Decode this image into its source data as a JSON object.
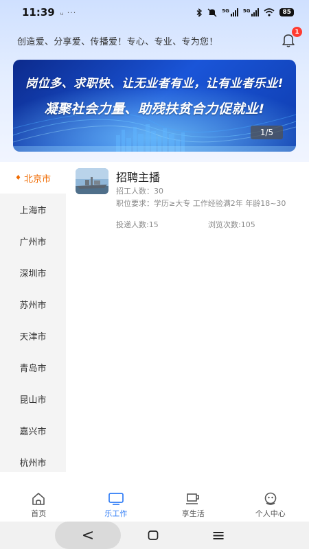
{
  "status_bar": {
    "time": "11:39",
    "extra": "ᵤ ···",
    "net1": "5G",
    "net2": "5G",
    "battery": "85"
  },
  "header": {
    "slogan": "创造爱、分享爱、传播爱！专心、专业、专为您！",
    "notification_count": "1"
  },
  "banner": {
    "line1": "岗位多、求职快、让无业者有业，让有业者乐业!",
    "line2": "凝聚社会力量、助残扶贫合力促就业!",
    "page_indicator": "1/5"
  },
  "cities": [
    {
      "name": "北京市"
    },
    {
      "name": "上海市"
    },
    {
      "name": "广州市"
    },
    {
      "name": "深圳市"
    },
    {
      "name": "苏州市"
    },
    {
      "name": "天津市"
    },
    {
      "name": "青岛市"
    },
    {
      "name": "昆山市"
    },
    {
      "name": "嘉兴市"
    },
    {
      "name": "杭州市"
    }
  ],
  "job": {
    "title": "招聘主播",
    "headcount": "招工人数：30",
    "requirements": "职位要求：学历≥大专 工作经验满2年 年龄18~30",
    "applications": "投递人数:15",
    "views": "浏览次数:105"
  },
  "tabs": [
    {
      "label": "首页",
      "icon": "home-icon"
    },
    {
      "label": "乐工作",
      "icon": "monitor-icon"
    },
    {
      "label": "享生活",
      "icon": "coffee-cup-icon"
    },
    {
      "label": "个人中心",
      "icon": "user-icon"
    }
  ],
  "system_nav": {
    "back": "<",
    "menu": "≡"
  },
  "colors": {
    "accent": "#2f7cf6",
    "active_city": "#f06a00",
    "badge": "#ff3b30",
    "banner": "#1a55d8"
  }
}
